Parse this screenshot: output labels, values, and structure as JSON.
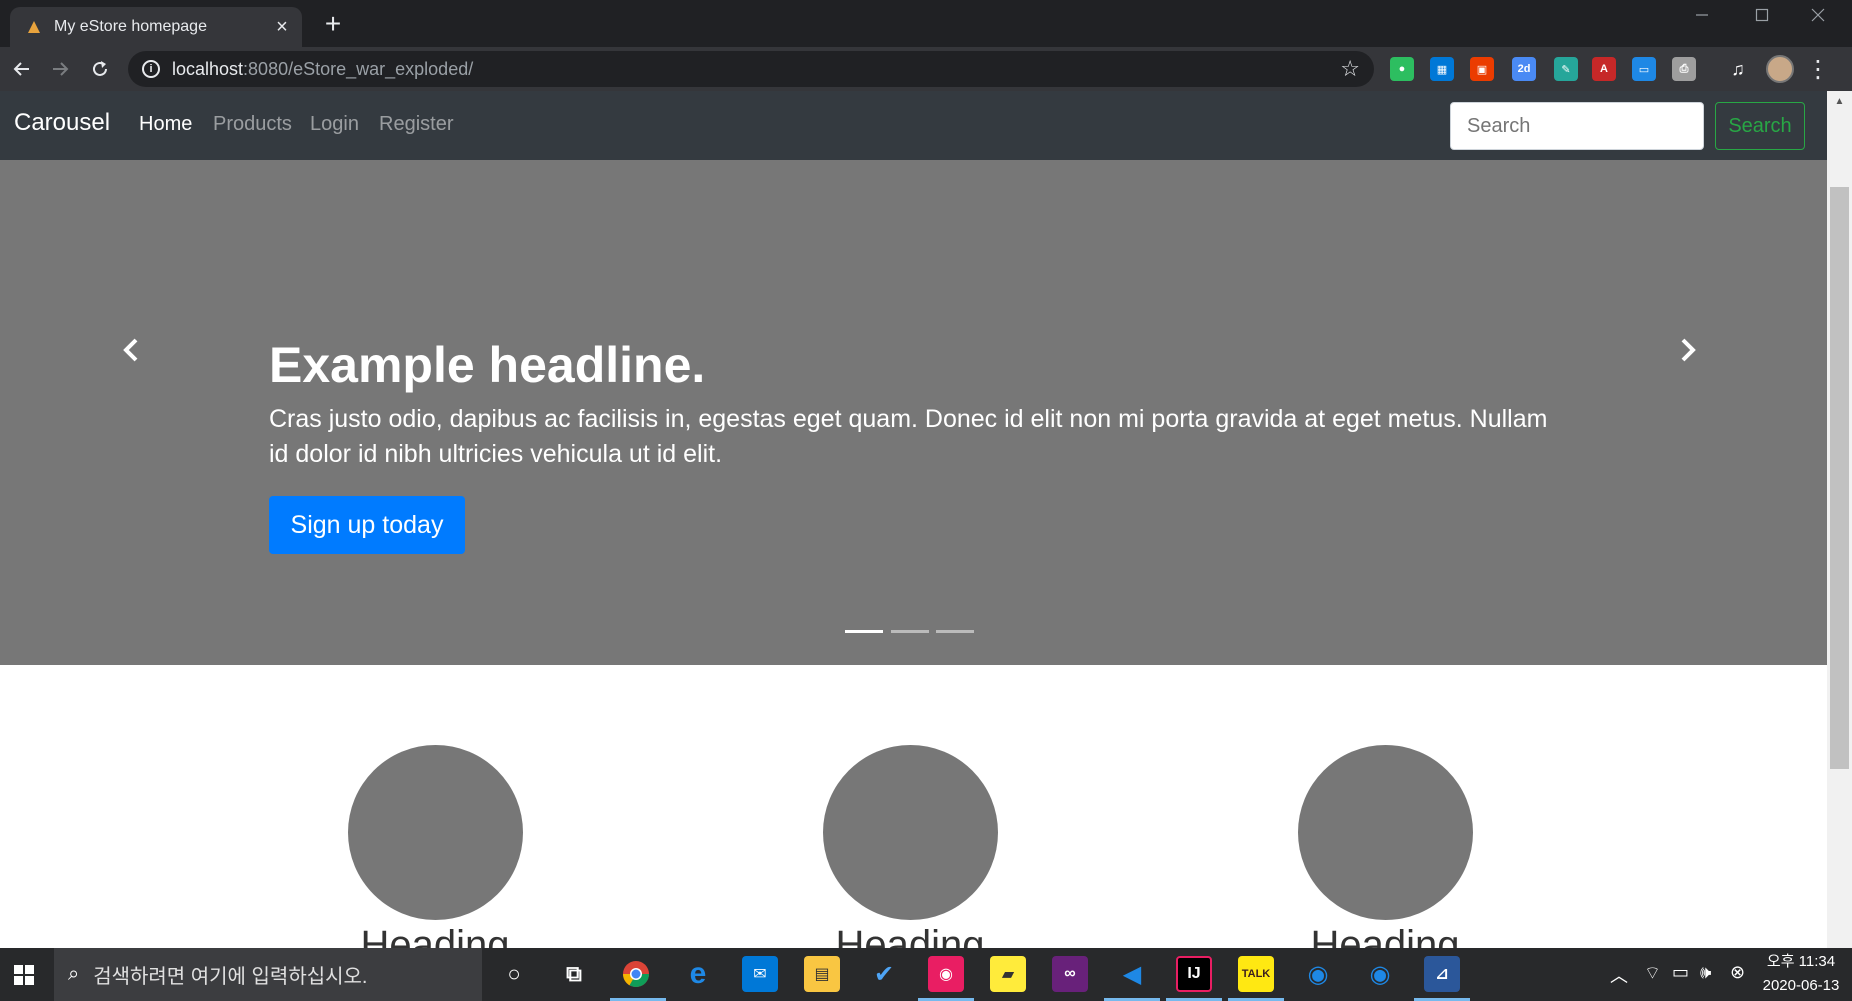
{
  "browser": {
    "tab_title": "My eStore homepage",
    "tab_close": "×",
    "new_tab": "+",
    "url_host": "localhost",
    "url_path": ":8080/eStore_war_exploded/",
    "extension_icons": [
      "evernote-icon",
      "windows-store-icon",
      "office-icon",
      "calendar-2d-icon",
      "pen-icon",
      "acrobat-icon",
      "screen-capture-icon",
      "printer-icon",
      "media-controls-icon"
    ]
  },
  "navbar": {
    "brand": "Carousel",
    "links": [
      "Home",
      "Products",
      "Login",
      "Register"
    ],
    "active_link": "Home",
    "search_placeholder": "Search",
    "search_button": "Search"
  },
  "carousel": {
    "headline": "Example headline.",
    "lead": "Cras justo odio, dapibus ac facilisis in, egestas eget quam. Donec id elit non mi porta gravida at eget metus. Nullam id dolor id nibh ultricies vehicula ut id elit.",
    "cta": "Sign up today",
    "slide_count": 3,
    "active_slide": 1
  },
  "marketing": {
    "headings": [
      "Heading",
      "Heading",
      "Heading"
    ]
  },
  "taskbar": {
    "search_placeholder": "검색하려면 여기에 입력하십시오.",
    "time": "오후 11:34",
    "date": "2020-06-13",
    "pinned_apps": [
      "cortana-icon",
      "task-view-icon",
      "chrome-icon",
      "edge-icon",
      "mail-icon",
      "file-explorer-icon",
      "todo-icon",
      "camera-icon",
      "sticky-notes-icon",
      "visual-studio-icon",
      "vscode-icon",
      "intellij-icon",
      "kakaotalk-icon",
      "maps-icon",
      "maps-icon",
      "sql-icon"
    ]
  },
  "colors": {
    "navbar_bg": "#343a40",
    "carousel_bg": "#777777",
    "primary": "#007bff",
    "success": "#28a745"
  }
}
